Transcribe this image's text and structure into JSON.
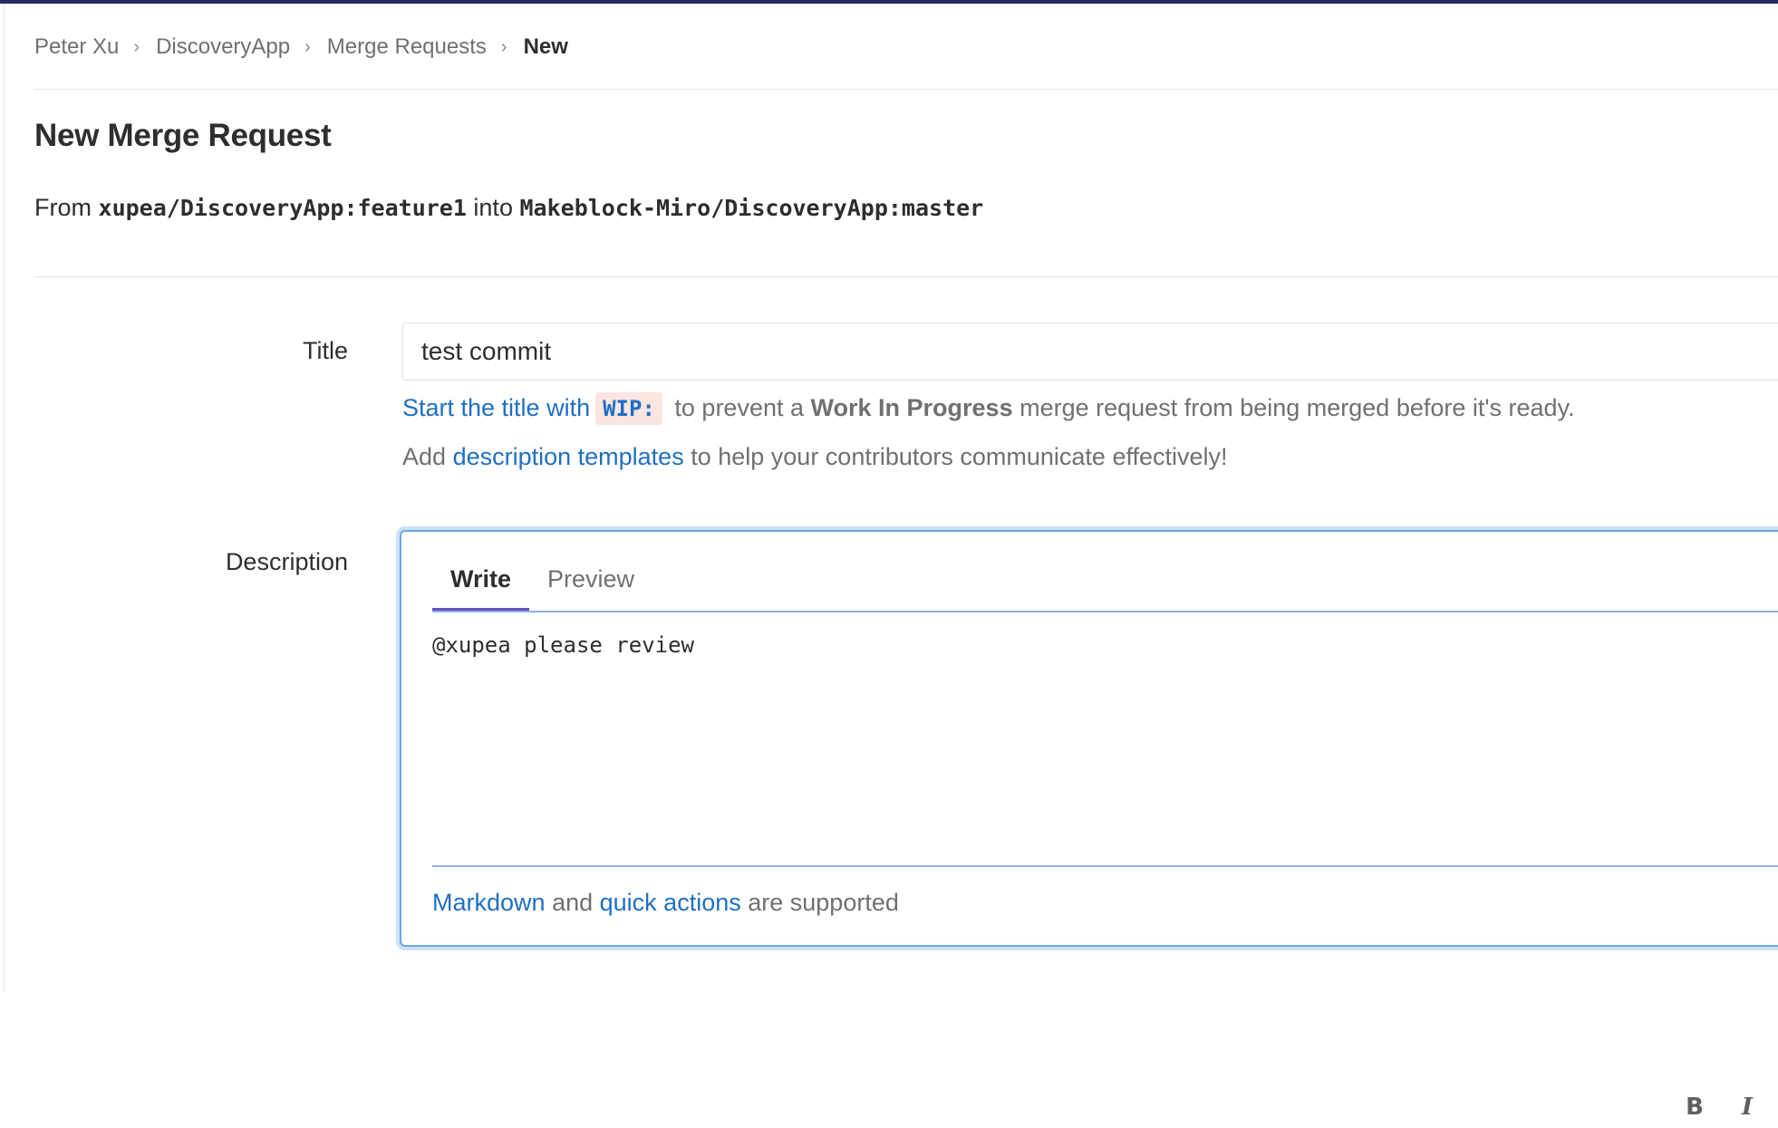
{
  "breadcrumb": {
    "items": [
      "Peter Xu",
      "DiscoveryApp",
      "Merge Requests"
    ],
    "current": "New"
  },
  "page_title": "New Merge Request",
  "branch_info": {
    "from_label": "From",
    "source": "xupea/DiscoveryApp:feature1",
    "into_label": "into",
    "target": "Makeblock-Miro/DiscoveryApp:master"
  },
  "form": {
    "title_label": "Title",
    "title_value": "test commit",
    "hint_wip": {
      "link_text": "Start the title with",
      "code": "WIP:",
      "middle": "to prevent a",
      "strong": "Work In Progress",
      "end": "merge request from being merged before it's ready."
    },
    "hint_templates": {
      "prefix": "Add",
      "link_text": "description templates",
      "suffix": "to help your contributors communicate effectively!"
    },
    "description_label": "Description",
    "tabs": [
      "Write",
      "Preview"
    ],
    "active_tab": "Write",
    "toolbar": {
      "bold": "B",
      "italic": "I",
      "quote": "❞"
    },
    "description_value": "@xupea please review",
    "footer": {
      "markdown_link": "Markdown",
      "and": "and",
      "quick_actions_link": "quick actions",
      "suffix": "are supported"
    }
  },
  "colors": {
    "top_bar": "#292961",
    "link": "#1f6fc5",
    "active_tab_underline": "#6b4fbb",
    "focus_border": "#6fa5e3"
  }
}
